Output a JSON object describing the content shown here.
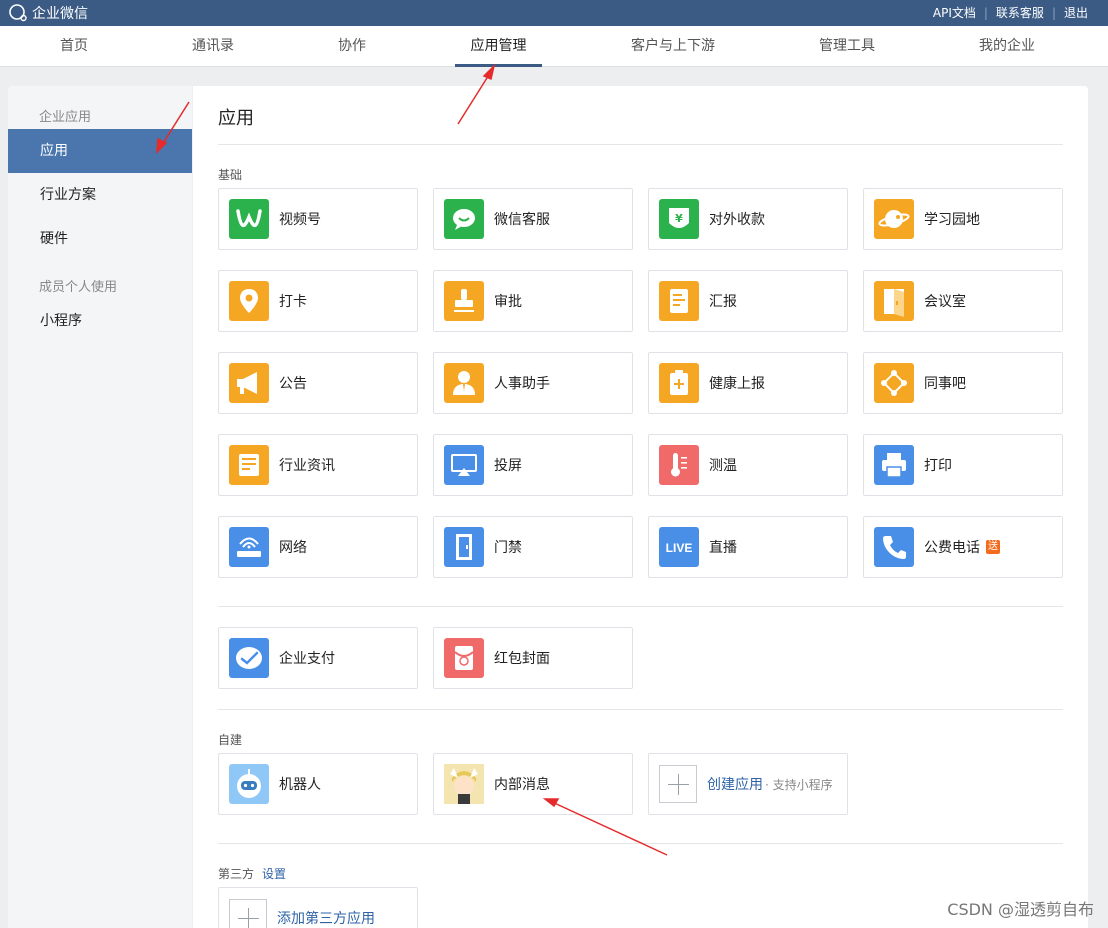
{
  "topbar": {
    "logo_text": "企业微信",
    "links": [
      "API文档",
      "联系客服",
      "退出"
    ]
  },
  "nav": {
    "tabs": [
      "首页",
      "通讯录",
      "协作",
      "应用管理",
      "客户与上下游",
      "管理工具",
      "我的企业"
    ],
    "active": "应用管理"
  },
  "sidebar": {
    "group1": "企业应用",
    "item_apps": "应用",
    "item_industry": "行业方案",
    "item_hardware": "硬件",
    "group2": "成员个人使用",
    "item_miniprogram": "小程序"
  },
  "main": {
    "title": "应用",
    "section_basic": "基础",
    "section_custom": "自建",
    "section_third": "第三方",
    "third_settings": "设置"
  },
  "apps_basic": [
    {
      "label": "视频号",
      "color": "#2bb24c",
      "icon": "channels-icon"
    },
    {
      "label": "微信客服",
      "color": "#2bb24c",
      "icon": "wechat-service-icon"
    },
    {
      "label": "对外收款",
      "color": "#2bb24c",
      "icon": "payment-icon"
    },
    {
      "label": "学习园地",
      "color": "#f5a623",
      "icon": "planet-icon"
    },
    {
      "label": "打卡",
      "color": "#f5a623",
      "icon": "location-icon"
    },
    {
      "label": "审批",
      "color": "#f5a623",
      "icon": "stamp-icon"
    },
    {
      "label": "汇报",
      "color": "#f5a623",
      "icon": "report-icon"
    },
    {
      "label": "会议室",
      "color": "#f5a623",
      "icon": "door-icon"
    },
    {
      "label": "公告",
      "color": "#f5a623",
      "icon": "megaphone-icon"
    },
    {
      "label": "人事助手",
      "color": "#f5a623",
      "icon": "person-icon"
    },
    {
      "label": "健康上报",
      "color": "#f5a623",
      "icon": "clipboard-plus-icon"
    },
    {
      "label": "同事吧",
      "color": "#f5a623",
      "icon": "network-icon"
    },
    {
      "label": "行业资讯",
      "color": "#f5a623",
      "icon": "news-icon"
    },
    {
      "label": "投屏",
      "color": "#4a8fe7",
      "icon": "screencast-icon"
    },
    {
      "label": "测温",
      "color": "#f06a6a",
      "icon": "thermometer-icon"
    },
    {
      "label": "打印",
      "color": "#4a8fe7",
      "icon": "printer-icon"
    },
    {
      "label": "网络",
      "color": "#4a8fe7",
      "icon": "router-icon"
    },
    {
      "label": "门禁",
      "color": "#4a8fe7",
      "icon": "door-access-icon"
    },
    {
      "label": "直播",
      "color": "#4a8fe7",
      "icon": "live-icon"
    },
    {
      "label": "公费电话",
      "color": "#4a8fe7",
      "icon": "phone-icon",
      "badge": "送"
    }
  ],
  "apps_extra": [
    {
      "label": "企业支付",
      "color": "#4a8fe7",
      "icon": "pay-icon"
    },
    {
      "label": "红包封面",
      "color": "#f06a6a",
      "icon": "red-envelope-icon"
    }
  ],
  "apps_custom": [
    {
      "label": "机器人",
      "color": "#8fc7f7",
      "icon": "robot-avatar-icon"
    },
    {
      "label": "内部消息",
      "color": "#f3d88a",
      "icon": "anime-avatar-icon"
    }
  ],
  "create_app": {
    "label": "创建应用",
    "sub": "· 支持小程序"
  },
  "add_third": {
    "label": "添加第三方应用"
  },
  "live_text": "LIVE",
  "yen_text": "¥",
  "watermark": "CSDN @湿透剪自布",
  "colors": {
    "topbar": "#3b5b85",
    "accent": "#4a76ad",
    "link": "#2f63a8"
  }
}
